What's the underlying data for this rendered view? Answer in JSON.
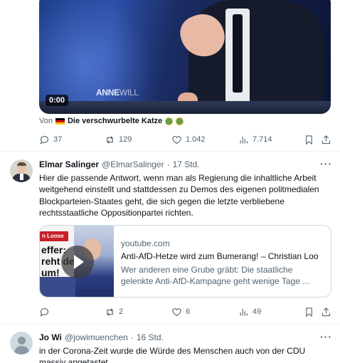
{
  "video": {
    "watermark_bold": "ANNE",
    "watermark_thin": "WILL",
    "timer": "0:00"
  },
  "video_source": {
    "prefix": "Von",
    "account": "Die verschwurbelte Katze"
  },
  "tweet1_actions": {
    "replies": "37",
    "retweets": "129",
    "likes": "1.042",
    "views": "7.714"
  },
  "tweet2": {
    "name": "Elmar Salinger",
    "handle": "@ElmarSalinger",
    "separator": "·",
    "time": "17 Std.",
    "more": "···",
    "text": "Hier die passende Antwort, wenn man als Regierung die inhaltliche Arbeit weitgehend einstellt und stattdessen zu Demos des eigenen politmedialen Blockparteien-Staates geht, die sich gegen die letzte verbliebene rechtsstaatliche Oppositionpartei richten.",
    "card": {
      "thumb_band": "n Loose",
      "thumb_headline": "effer: reht der um!",
      "domain": "youtube.com",
      "title": "Anti-AfD-Hetze wird zum Bumerang! – Christian Loo",
      "description": "Wer anderen eine Grube gräbt: Die staatliche gelenkte Anti-AfD-Kampagne geht wenige Tage ..."
    },
    "actions": {
      "replies": "",
      "retweets": "2",
      "likes": "6",
      "views": "49"
    }
  },
  "tweet3": {
    "name": "Jo Wi",
    "handle": "@jowimuenchen",
    "separator": "·",
    "time": "16 Std.",
    "more": "···",
    "text": "in der Corona-Zeit wurde die Würde des Menschen auch von der CDU massiv angetastet"
  }
}
